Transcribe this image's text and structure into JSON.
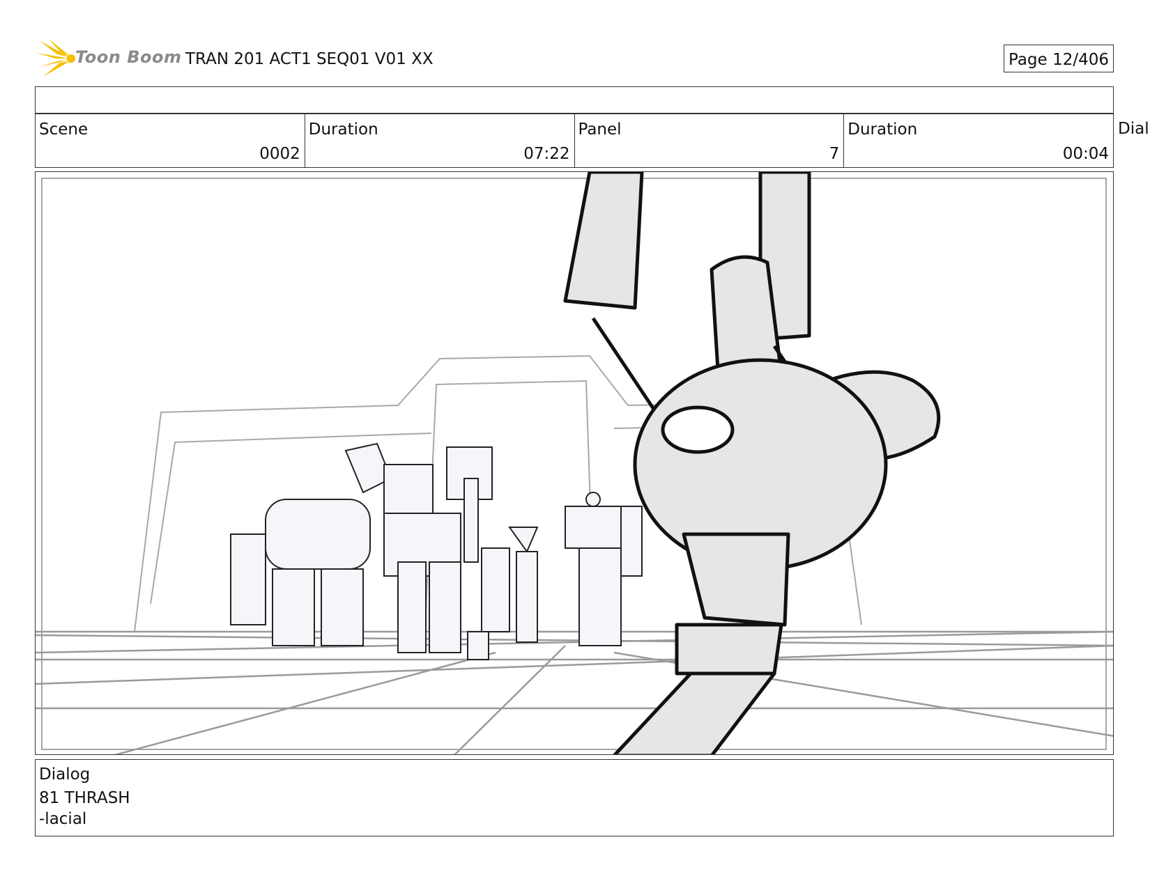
{
  "header": {
    "brand": "Toon Boom",
    "title": "TRAN 201 ACT1 SEQ01 V01 XX",
    "page_label": "Page",
    "page_number": "12/406"
  },
  "info": {
    "scene_label": "Scene",
    "scene_value": "0002",
    "scene_duration_label": "Duration",
    "scene_duration_value": "07:22",
    "panel_label": "Panel",
    "panel_value": "7",
    "panel_duration_label": "Duration",
    "panel_duration_value": "00:04",
    "overflow_label": "Dialo"
  },
  "dialog": {
    "label": "Dialog",
    "line1": "81 THRASH",
    "line2": "-lacial"
  },
  "colors": {
    "logo_yellow": "#f5c000",
    "sketch_fill": "#e6e6e6",
    "figure_fill": "#f4f6fa",
    "grid_line": "#9a9a9a"
  }
}
